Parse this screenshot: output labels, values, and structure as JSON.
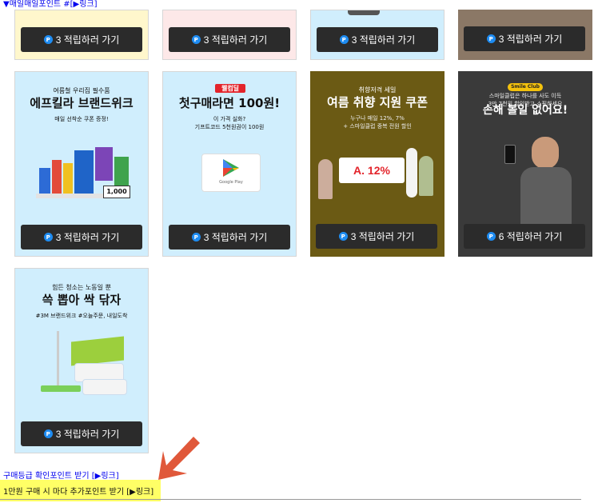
{
  "top_link": {
    "text": "▼매일매일포인트 #[▶링크]"
  },
  "button_label": "3 적립하러 가기",
  "button_label_6": "6 적립하러 가기",
  "p_icon": "P",
  "cards": [
    {
      "head1": "여름철 우리집 필수품",
      "head2": "에프킬라 브랜드위크",
      "head3": "매일 선착순 쿠폰 증정!",
      "badge": "1,000"
    },
    {
      "head1": "웰컴딜",
      "head2": "첫구매라면 100원!",
      "head3": "이 가격 실화?\n기프트코드 5천원권이 100원",
      "gp": "Google Play"
    },
    {
      "head1": "취향저격 세일",
      "head2": "여름 취향 지원 쿠폰",
      "head3": "누구나 매일 12%, 7%\n+ 스마일클럽 중복 전원 할인",
      "coupon": "A. 12%"
    },
    {
      "head1": "Smile Club",
      "head2": "손해 볼일 없어요!",
      "head3": "스마일클럽은 하나를 사도 이득\n3만 7천원 할인받고 쇼핑하세요"
    },
    {
      "head1": "힘든 청소는 노동일 뿐",
      "head2": "쓱 뽑아 싹 닦자",
      "head3": "#3M 브랜드위크 #오늘주문, 내일도착"
    }
  ],
  "bottom_link": "구매등급 확인포인트 받기 [▶링크]",
  "yellow_link": "1만원 구매 시 마다 추가포인트 받기 [▶링크]",
  "colors": {
    "card_yellow": "#fff7cc",
    "card_pink": "#fde8e8",
    "card_blue": "#d0eefd",
    "card_brown": "#8b7866",
    "card_olive": "#6b5a14",
    "card_dark": "#3a3a3a",
    "button": "#2b2b2b",
    "p_icon": "#1e8cf2",
    "arrow": "#e0583a"
  }
}
